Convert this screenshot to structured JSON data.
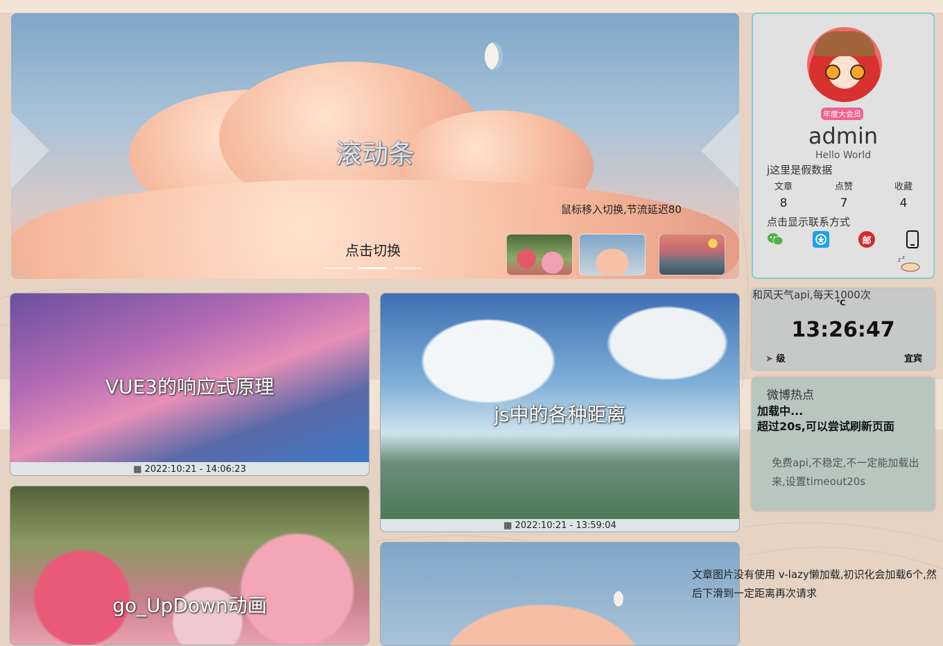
{
  "colors": {
    "accent_border": "#7ccfd2",
    "badge": "#f06292",
    "page_bg": "#e6d3c3"
  },
  "carousel": {
    "title": "滚动条",
    "note": "鼠标移入切换,节流延迟80",
    "click_label": "点击切换",
    "dots_count": 3,
    "active_dot": 1
  },
  "profile": {
    "badge": "年度大会员",
    "name": "admin",
    "motto": "Hello World",
    "fake_note": "j这里是假数据",
    "stats": [
      {
        "label": "文章",
        "value": "8"
      },
      {
        "label": "点赞",
        "value": "7"
      },
      {
        "label": "收藏",
        "value": "4"
      }
    ],
    "contact_note": "点击显示联系方式",
    "contact_icons": [
      "wechat-icon",
      "qq-icon",
      "mail-icon",
      "phone-icon"
    ]
  },
  "weather": {
    "note": "和风天气api,每天1000次",
    "unit": "℃",
    "time": "13:26:47",
    "wind": "级",
    "city": "宜宾"
  },
  "weibo": {
    "title": "微博热点",
    "loading": "加载中...",
    "loading_hint": "超过20s,可以尝试刷新页面",
    "note": "免费api,不稳定,不一定能加载出来,设置timeout20s"
  },
  "articles": [
    {
      "title": "VUE3的响应式原理",
      "date": "2022:10:21 - 14:06:23"
    },
    {
      "title": "js中的各种距离",
      "date": "2022:10:21 - 13:59:04"
    },
    {
      "title": "go_UpDown动画",
      "date": ""
    },
    {
      "title": "",
      "date": ""
    }
  ],
  "bottom_note": "文章图片没有使用 v-lazy懒加载,初识化会加载6个,然后下滑到一定距离再次请求"
}
